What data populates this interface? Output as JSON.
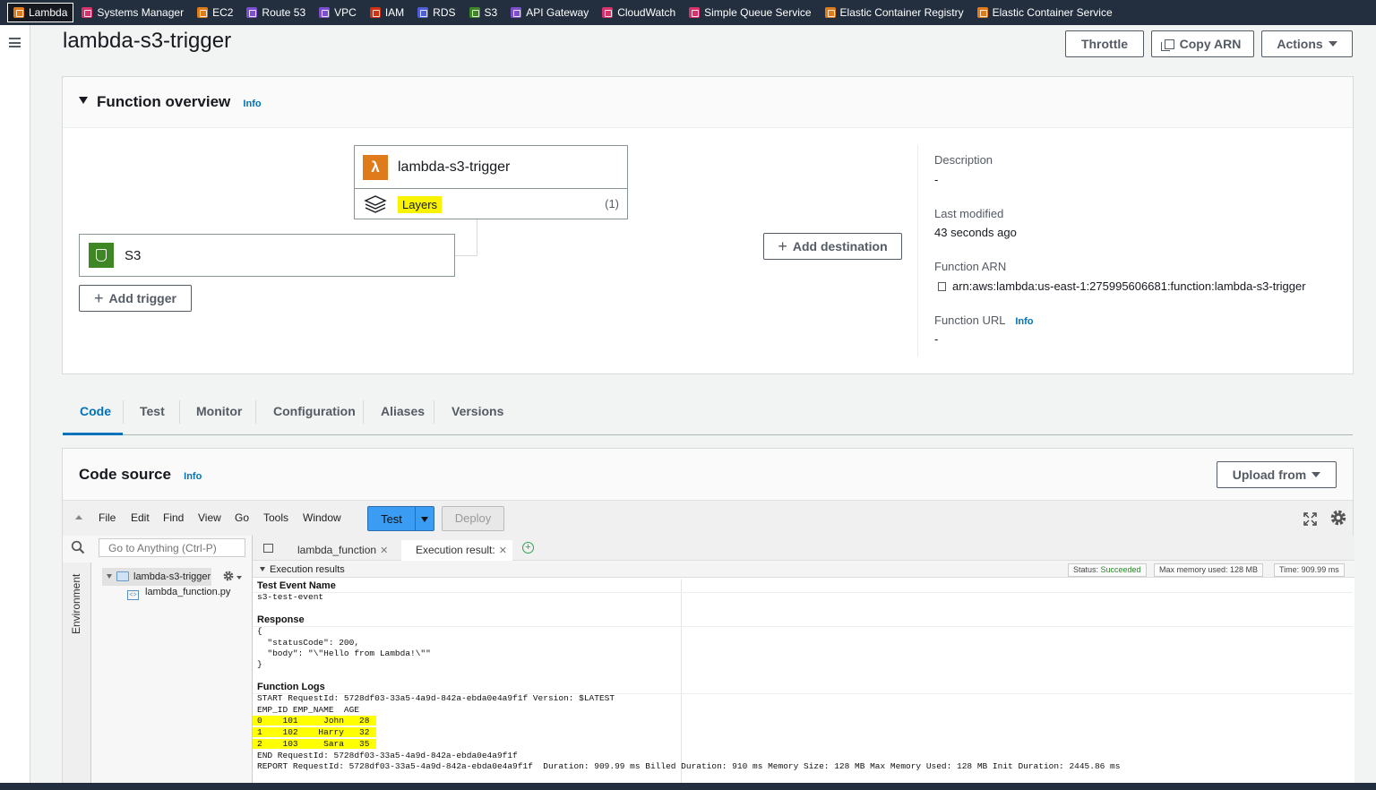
{
  "topbar": {
    "services": [
      {
        "label": "Lambda",
        "icon": "lambda-icon",
        "color": "#e07b1c",
        "active": true
      },
      {
        "label": "Systems Manager",
        "icon": "systems-manager-icon",
        "color": "#d6336c"
      },
      {
        "label": "EC2",
        "icon": "ec2-icon",
        "color": "#e07b1c"
      },
      {
        "label": "Route 53",
        "icon": "route53-icon",
        "color": "#7b4fd0"
      },
      {
        "label": "VPC",
        "icon": "vpc-icon",
        "color": "#7b4fd0"
      },
      {
        "label": "IAM",
        "icon": "iam-icon",
        "color": "#d13212"
      },
      {
        "label": "RDS",
        "icon": "rds-icon",
        "color": "#4e5fd6"
      },
      {
        "label": "S3",
        "icon": "s3-icon",
        "color": "#3f8624"
      },
      {
        "label": "API Gateway",
        "icon": "api-gateway-icon",
        "color": "#7b4fd0"
      },
      {
        "label": "CloudWatch",
        "icon": "cloudwatch-icon",
        "color": "#d6336c"
      },
      {
        "label": "Simple Queue Service",
        "icon": "sqs-icon",
        "color": "#d6336c"
      },
      {
        "label": "Elastic Container Registry",
        "icon": "ecr-icon",
        "color": "#e07b1c"
      },
      {
        "label": "Elastic Container Service",
        "icon": "ecs-icon",
        "color": "#e07b1c"
      }
    ]
  },
  "header": {
    "title": "lambda-s3-trigger",
    "throttle_label": "Throttle",
    "copy_arn_label": "Copy ARN",
    "actions_label": "Actions"
  },
  "overview": {
    "title": "Function overview",
    "info_label": "Info",
    "function_name": "lambda-s3-trigger",
    "layers_label": "Layers",
    "layers_count": "(1)",
    "trigger_name": "S3",
    "add_trigger_label": "Add trigger",
    "add_destination_label": "Add destination",
    "description_label": "Description",
    "description_value": "-",
    "last_modified_label": "Last modified",
    "last_modified_value": "43 seconds ago",
    "arn_label": "Function ARN",
    "arn_value": "arn:aws:lambda:us-east-1:275995606681:function:lambda-s3-trigger",
    "url_label": "Function URL",
    "url_info": "Info",
    "url_value": "-"
  },
  "tabs": [
    "Code",
    "Test",
    "Monitor",
    "Configuration",
    "Aliases",
    "Versions"
  ],
  "code_source": {
    "title": "Code source",
    "info_label": "Info",
    "upload_label": "Upload from",
    "menu": [
      "File",
      "Edit",
      "Find",
      "View",
      "Go",
      "Tools",
      "Window"
    ],
    "test_label": "Test",
    "deploy_label": "Deploy",
    "goto_placeholder": "Go to Anything (Ctrl-P)",
    "environment_label": "Environment",
    "folder_name": "lambda-s3-trigger",
    "file_name": "lambda_function.py",
    "editor_tabs": [
      {
        "label": "lambda_function"
      },
      {
        "label": "Execution result:"
      }
    ]
  },
  "execution": {
    "section_title": "Execution results",
    "status_prefix": "Status:",
    "status_value": "Succeeded",
    "max_memory": "Max memory used: 128 MB",
    "time": "Time: 909.99 ms",
    "test_event_label": "Test Event Name",
    "test_event_value": "s3-test-event",
    "response_label": "Response",
    "response_lines": [
      "{",
      "  \"statusCode\": 200,",
      "  \"body\": \"\\\"Hello from Lambda!\\\"\"",
      "}"
    ],
    "logs_label": "Function Logs",
    "log_start": "START RequestId: 5728df03-33a5-4a9d-842a-ebda0e4a9f1f Version: $LATEST",
    "log_header": "EMP_ID EMP_NAME  AGE",
    "log_rows": [
      "0    101     John   28",
      "1    102    Harry   32",
      "2    103     Sara   35"
    ],
    "log_end": "END RequestId: 5728df03-33a5-4a9d-842a-ebda0e4a9f1f",
    "log_report": "REPORT RequestId: 5728df03-33a5-4a9d-842a-ebda0e4a9f1f  Duration: 909.99 ms Billed Duration: 910 ms Memory Size: 128 MB Max Memory Used: 128 MB Init Duration: 2445.86 ms"
  }
}
